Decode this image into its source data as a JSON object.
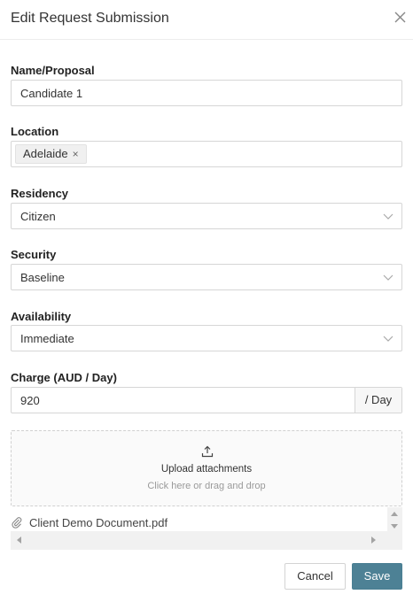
{
  "dialog": {
    "title": "Edit Request Submission",
    "close_icon": "close-icon"
  },
  "form": {
    "name": {
      "label": "Name/Proposal",
      "value": "Candidate 1"
    },
    "location": {
      "label": "Location",
      "tags": [
        "Adelaide"
      ],
      "tag_remove": "×"
    },
    "residency": {
      "label": "Residency",
      "value": "Citizen"
    },
    "security": {
      "label": "Security",
      "value": "Baseline"
    },
    "availability": {
      "label": "Availability",
      "value": "Immediate"
    },
    "charge": {
      "label": "Charge (AUD / Day)",
      "value": "920",
      "suffix": "/ Day"
    }
  },
  "upload": {
    "title": "Upload attachments",
    "hint": "Click here or drag and drop",
    "icon": "upload-icon"
  },
  "attachments": [
    {
      "name": "Client Demo Document.pdf",
      "icon": "paperclip-icon"
    }
  ],
  "actions": {
    "cancel_label": "Cancel",
    "save_label": "Save"
  },
  "colors": {
    "save_button": "#4d8195",
    "border": "#d6d6d6"
  }
}
